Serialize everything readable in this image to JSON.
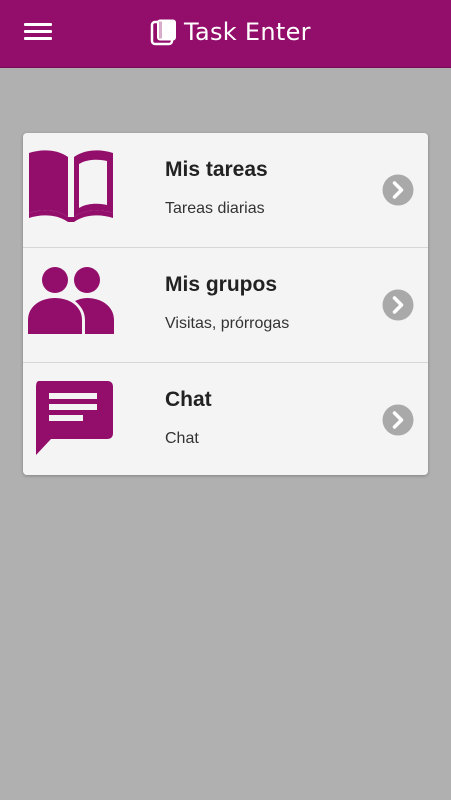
{
  "header": {
    "app_name": "Task Enter",
    "menu_icon": "hamburger-menu-icon",
    "logo_icon": "task-enter-logo-icon",
    "background_color": "#930d6b"
  },
  "menu": {
    "items": [
      {
        "title": "Mis tareas",
        "subtitle": "Tareas diarias",
        "icon": "open-book-icon"
      },
      {
        "title": "Mis grupos",
        "subtitle": "Visitas, prórrogas",
        "icon": "group-people-icon"
      },
      {
        "title": "Chat",
        "subtitle": "Chat",
        "icon": "chat-bubble-icon"
      }
    ],
    "icon_color": "#930d6b",
    "chevron_icon": "chevron-right-circle-icon"
  }
}
